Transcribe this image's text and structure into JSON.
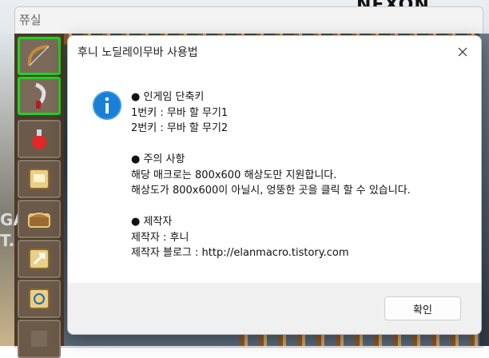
{
  "background": {
    "logo_text": "NEXON",
    "window_title": "쮸실",
    "game_text": [
      "GA",
      "T."
    ],
    "slots": [
      {
        "icon": "bow-icon",
        "selected": true
      },
      {
        "icon": "sickle-icon",
        "selected": true
      },
      {
        "icon": "potion-icon",
        "selected": false
      },
      {
        "icon": "scroll-icon",
        "selected": false
      },
      {
        "icon": "chest-icon",
        "selected": false
      },
      {
        "icon": "skill-icon",
        "selected": false
      },
      {
        "icon": "book-icon",
        "selected": false
      },
      {
        "icon": "empty-slot-icon",
        "selected": false
      }
    ]
  },
  "dialog": {
    "title": "후니 노딜레이무바 사용법",
    "icon": "info-icon",
    "sections": [
      {
        "heading": "● 인게임 단축키",
        "lines": [
          "1번키 : 무바 할 무기1",
          "2번키 : 무바 할 무기2"
        ]
      },
      {
        "heading": "● 주의 사항",
        "lines": [
          "해당 매크로는 800x600 해상도만 지원합니다.",
          "해상도가 800x600이 아닐시, 엉뚱한 곳을 클릭 할 수 있습니다."
        ]
      },
      {
        "heading": "● 제작자",
        "lines": [
          "제작자 : 후니",
          "제작자 블로그 : http://elanmacro.tistory.com"
        ]
      }
    ],
    "ok_label": "확인",
    "accent_color": "#1a7fd6"
  }
}
